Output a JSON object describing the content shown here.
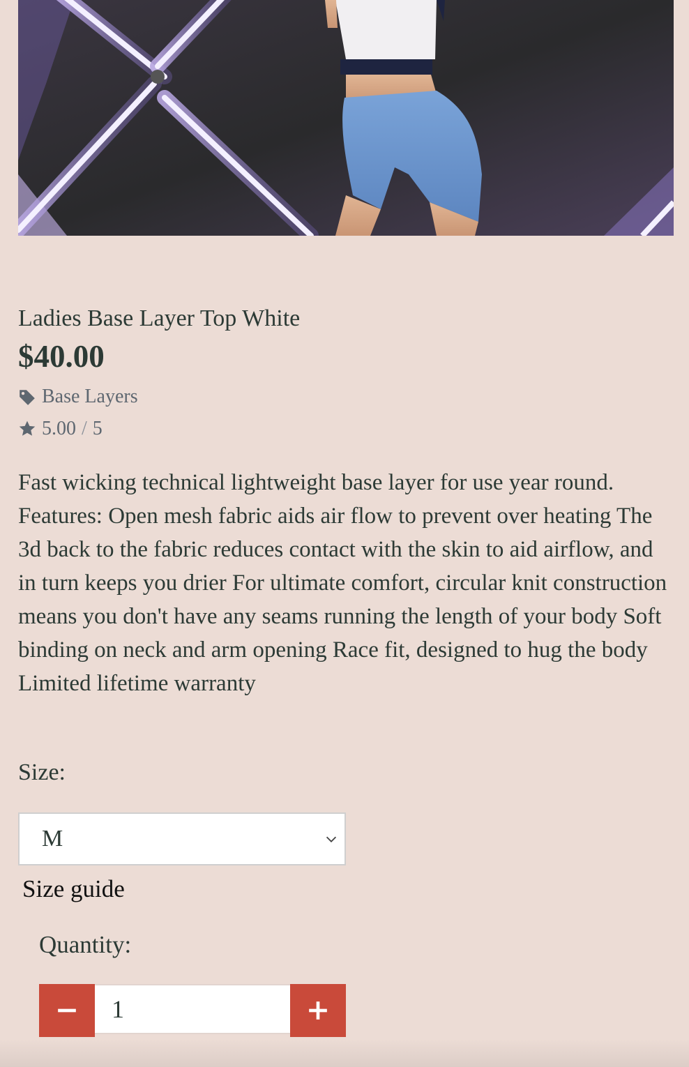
{
  "product": {
    "image_alt": "Woman wearing white sports top and blue shorts against a wall with crossed light tubes",
    "title": "Ladies Base Layer Top White",
    "price": "$40.00",
    "category": "Base Layers",
    "rating_value": "5.00",
    "rating_sep": "/",
    "rating_max": "5",
    "description": "Fast wicking technical lightweight base layer for use year round. Features: Open mesh fabric aids air flow to prevent over heating The 3d back to the fabric reduces contact with the skin to aid airflow, and in turn keeps you drier For ultimate comfort, circular knit construction means you don't have any seams running the length of your body Soft binding on neck and arm opening Race fit, designed to hug the body Limited lifetime warranty"
  },
  "size": {
    "label": "Size:",
    "selected": "M",
    "guide_link": "Size guide"
  },
  "quantity": {
    "label": "Quantity:",
    "value": "1"
  },
  "icons": {
    "category": "tag-icon",
    "rating": "star-icon",
    "dropdown": "chevron-down-icon",
    "decrease": "minus-icon",
    "increase": "plus-icon"
  },
  "colors": {
    "background": "#ecdcd5",
    "accent": "#c94a3a",
    "text": "#2c3a35",
    "muted": "#5e6770"
  }
}
